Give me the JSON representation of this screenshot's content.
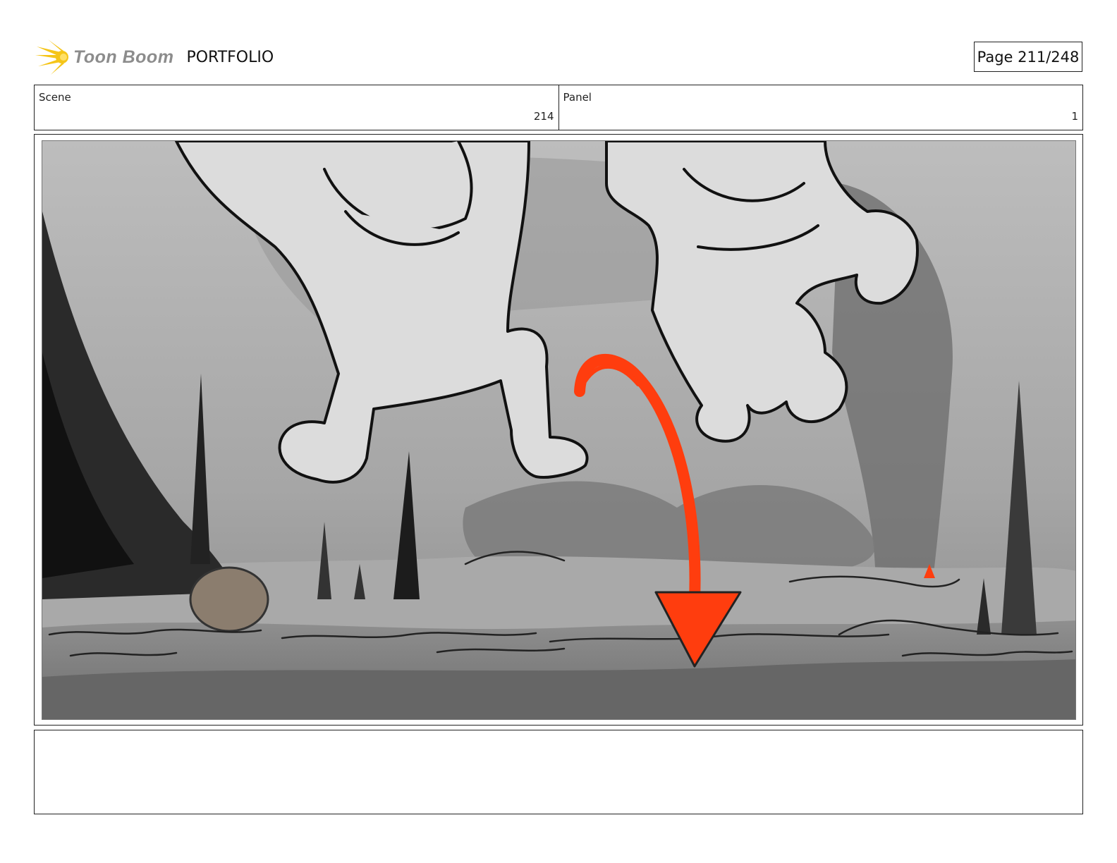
{
  "header": {
    "logo_text": "Toon Boom",
    "section_title": "PORTFOLIO",
    "page_indicator": "Page 211/248"
  },
  "info": {
    "scene_label": "Scene",
    "scene_value": "214",
    "panel_label": "Panel",
    "panel_value": "1"
  },
  "panel": {
    "image_description_icon": "storyboard-sketch",
    "accent_color": "#ff3d0e"
  },
  "notes": {
    "text": ""
  }
}
